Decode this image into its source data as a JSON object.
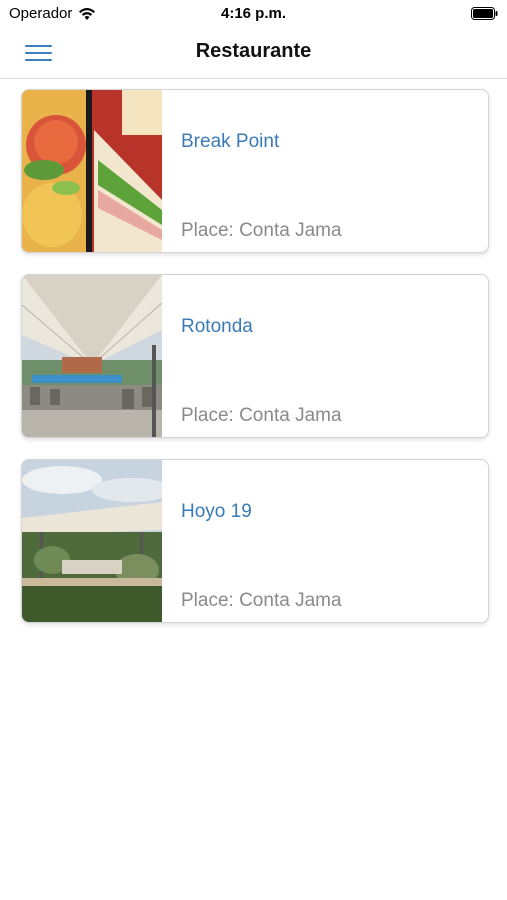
{
  "status_bar": {
    "carrier": "Operador",
    "time": "4:16 p.m."
  },
  "nav": {
    "title": "Restaurante",
    "accent_color": "#3b7fbf"
  },
  "restaurants": [
    {
      "name": "Break Point",
      "place": "Place: Conta Jama",
      "image": "food-photo"
    },
    {
      "name": "Rotonda",
      "place": "Place: Conta Jama",
      "image": "tent-terrace-photo"
    },
    {
      "name": "Hoyo 19",
      "place": "Place: Conta Jama",
      "image": "garden-tent-photo"
    }
  ]
}
